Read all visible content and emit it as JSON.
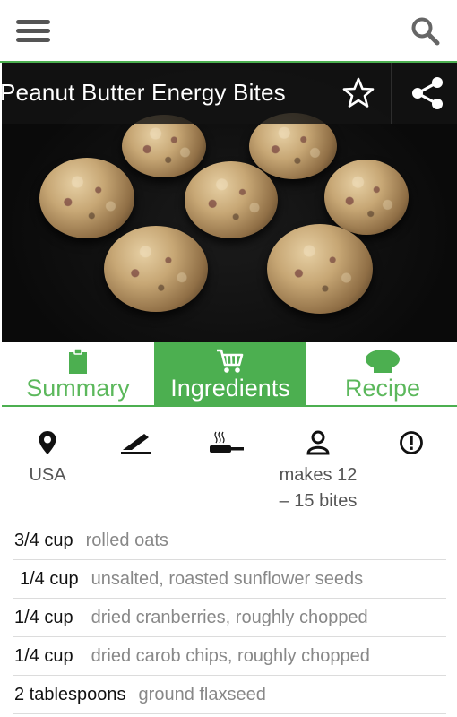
{
  "appbar": {
    "menu_icon": "hamburger-menu-icon",
    "search_icon": "search-icon",
    "accent": "#4caf50"
  },
  "hero": {
    "title": "Peanut Butter Energy Bites",
    "star_icon": "star-outline-icon",
    "share_icon": "share-icon"
  },
  "tabs": [
    {
      "label": "Summary",
      "icon": "clipboard-icon",
      "active": false
    },
    {
      "label": "Ingredients",
      "icon": "shopping-cart-icon",
      "active": true
    },
    {
      "label": "Recipe",
      "icon": "chef-hat-icon",
      "active": false
    }
  ],
  "info": {
    "origin": "USA",
    "servings_line1": "makes 12",
    "servings_line2": "– 15 bites",
    "icons": [
      "location-pin-icon",
      "knife-icon",
      "frying-pan-icon",
      "person-icon",
      "alert-icon"
    ]
  },
  "ingredients": [
    {
      "qty": "3/4 cup",
      "item": "rolled oats"
    },
    {
      "qty": "1/4 cup",
      "item": "unsalted, roasted sunflower seeds"
    },
    {
      "qty": "1/4 cup",
      "item": "dried cranberries, roughly chopped"
    },
    {
      "qty": "1/4 cup",
      "item": "dried carob chips, roughly chopped"
    },
    {
      "qty": "2 tablespoons",
      "item": "ground flaxseed"
    }
  ]
}
